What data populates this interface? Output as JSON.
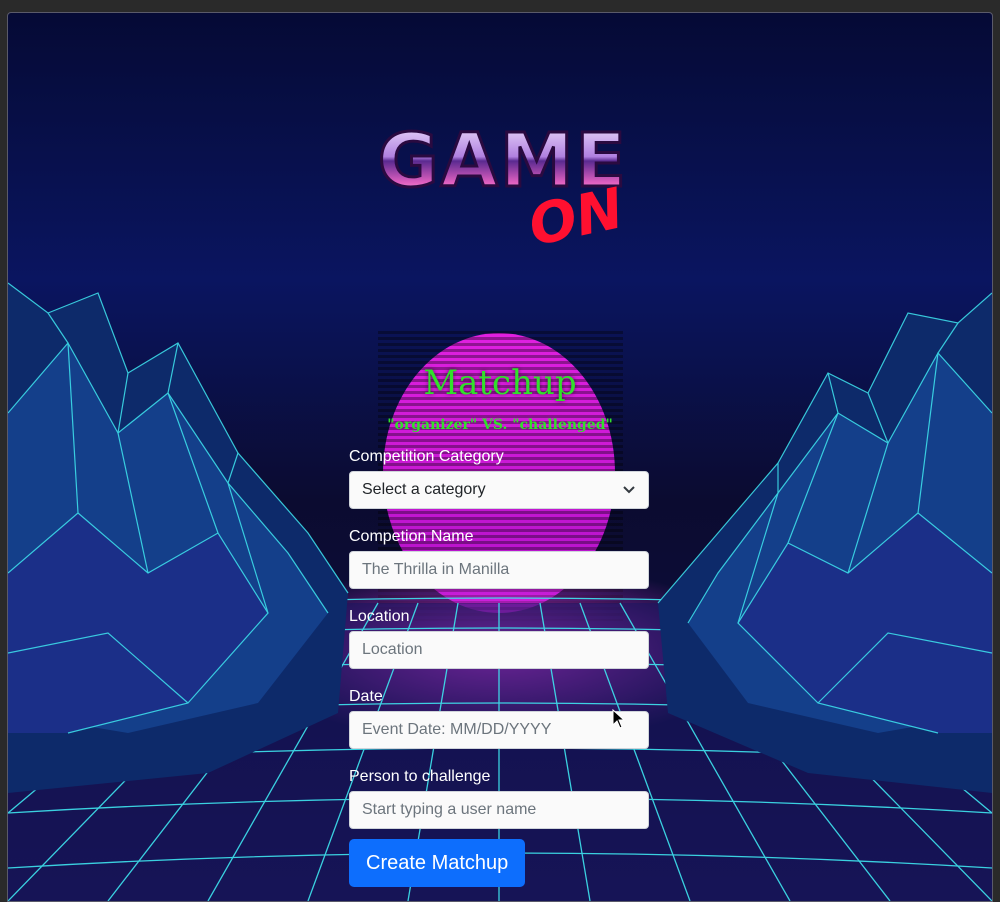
{
  "logo": {
    "top_word": "GAME",
    "bottom_word": "ON"
  },
  "heading": {
    "title": "Matchup",
    "subtitle": "\"organizer\" VS. \"challenged\""
  },
  "form": {
    "category_label": "Competition Category",
    "category_selected": "Select a category",
    "name_label": "Competion Name",
    "name_placeholder": "The Thrilla in Manilla",
    "location_label": "Location",
    "location_placeholder": "Location",
    "date_label": "Date",
    "date_placeholder": "Event Date: MM/DD/YYYY",
    "challenge_label": "Person to challenge",
    "challenge_placeholder": "Start typing a user name",
    "submit_label": "Create Matchup"
  },
  "colors": {
    "accent": "#31e02b",
    "button": "#0d6efd",
    "sun": "#d21ad8",
    "grid": "#3fe6f0"
  }
}
